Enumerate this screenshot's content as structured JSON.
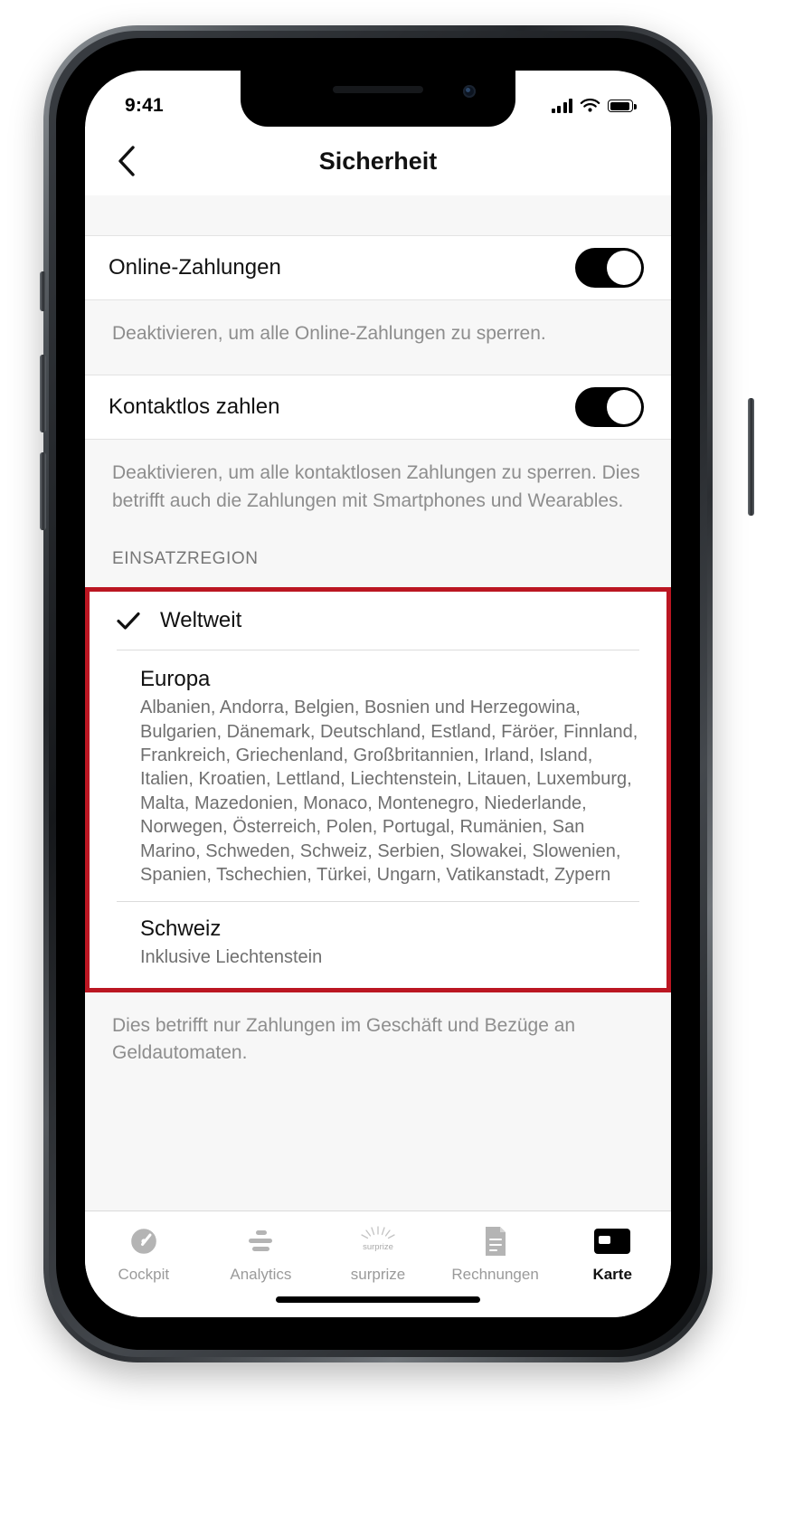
{
  "statusbar": {
    "time": "9:41",
    "signal_icon": "cellular-signal-icon",
    "wifi_icon": "wifi-icon",
    "battery_icon": "battery-icon"
  },
  "navbar": {
    "back_icon": "chevron-left-icon",
    "title": "Sicherheit"
  },
  "settings": {
    "online_payments": {
      "label": "Online-Zahlungen",
      "toggle_state": "on",
      "note": "Deaktivieren, um alle Online-Zahlungen zu sperren."
    },
    "contactless": {
      "label": "Kontaktlos zahlen",
      "toggle_state": "on",
      "note": "Deaktivieren, um alle kontaktlosen Zahlungen zu sperren. Dies betrifft auch die Zahlungen mit Smartphones und Wearables."
    }
  },
  "region_section": {
    "header": "EINSATZREGION",
    "highlight_color": "#bb1622",
    "options": [
      {
        "name": "Weltweit",
        "selected": true,
        "check_icon": "checkmark-icon",
        "subtitle": ""
      },
      {
        "name": "Europa",
        "selected": false,
        "subtitle": "Albanien, Andorra, Belgien, Bosnien und Herzegowina, Bulgarien, Dänemark, Deutschland, Estland, Färöer, Finnland, Frankreich, Griechenland, Großbritannien, Irland, Island, Italien, Kroatien, Lettland, Liechtenstein, Litauen, Luxemburg, Malta, Mazedonien, Monaco, Montenegro, Niederlande, Norwegen, Österreich, Polen, Portugal, Rumänien, San Marino, Schweden, Schweiz, Serbien, Slowakei, Slowenien, Spanien, Tschechien, Türkei, Ungarn, Vatikanstadt, Zypern"
      },
      {
        "name": "Schweiz",
        "selected": false,
        "subtitle": "Inklusive Liechtenstein"
      }
    ],
    "footer_note": "Dies betrifft nur Zahlungen im Geschäft und Bezüge an Geldautomaten."
  },
  "tabbar": {
    "tabs": [
      {
        "label": "Cockpit",
        "icon": "speedometer-icon",
        "active": false
      },
      {
        "label": "Analytics",
        "icon": "bar-chart-icon",
        "active": false
      },
      {
        "label": "surprize",
        "icon": "sunburst-icon",
        "active": false
      },
      {
        "label": "Rechnungen",
        "icon": "document-icon",
        "active": false
      },
      {
        "label": "Karte",
        "icon": "card-icon",
        "active": true
      }
    ]
  }
}
